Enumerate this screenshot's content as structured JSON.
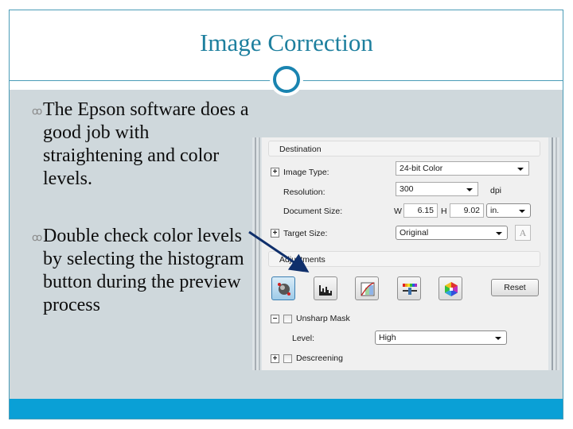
{
  "slide": {
    "title": "Image Correction",
    "colors": {
      "title": "#1d7f9e",
      "accent_line": "#4a9cb7",
      "body_background": "#cfd8dc",
      "footer_bar": "#0aa0d6",
      "arrow": "#0f2f6b"
    },
    "bullets": [
      {
        "icon": "scroll-bullet-icon",
        "glyph": "ꝏ",
        "text": "The Epson software does a good job with straightening and color levels."
      },
      {
        "icon": "scroll-bullet-icon",
        "glyph": "ꝏ",
        "text": "Double check color levels by selecting the histogram button during the preview process"
      }
    ]
  },
  "screenshot": {
    "destination": {
      "header": "Destination",
      "image_type_label": "Image Type:",
      "image_type_value": "24-bit Color",
      "resolution_label": "Resolution:",
      "resolution_value": "300",
      "resolution_unit": "dpi",
      "document_size_label": "Document Size:",
      "width_label": "W",
      "width_value": "6.15",
      "height_label": "H",
      "height_value": "9.02",
      "size_unit": "in.",
      "target_size_label": "Target Size:",
      "target_size_value": "Original",
      "font_button": "A"
    },
    "adjustments": {
      "header": "Adjustments",
      "tools": [
        {
          "name": "auto-exposure",
          "icon": "auto-exposure-icon",
          "active": true
        },
        {
          "name": "histogram",
          "icon": "histogram-icon",
          "active": false
        },
        {
          "name": "tone-correction",
          "icon": "tone-curve-icon",
          "active": false
        },
        {
          "name": "image-adjustment",
          "icon": "color-slider-icon",
          "active": false
        },
        {
          "name": "color-palette",
          "icon": "color-palette-icon",
          "active": false
        }
      ],
      "reset_label": "Reset",
      "unsharp_mask_label": "Unsharp Mask",
      "unsharp_mask_checked": false,
      "level_label": "Level:",
      "level_value": "High",
      "descreening_label": "Descreening",
      "descreening_checked": false
    }
  }
}
